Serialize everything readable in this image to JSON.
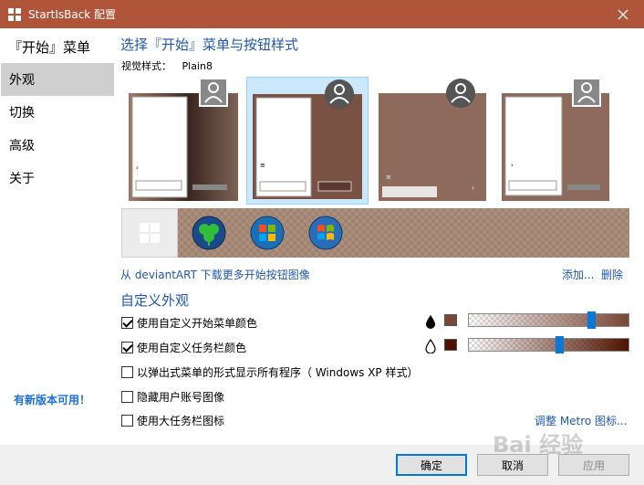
{
  "window": {
    "title": "StartIsBack 配置"
  },
  "sidebar": {
    "heading": "『开始』菜单",
    "items": [
      {
        "label": "外观",
        "active": true
      },
      {
        "label": "切换",
        "active": false
      },
      {
        "label": "高级",
        "active": false
      },
      {
        "label": "关于",
        "active": false
      }
    ],
    "update_link": "有新版本可用！"
  },
  "appearance": {
    "section_title": "选择『开始』菜单与按钮样式",
    "visual_style_label": "视觉样式：",
    "visual_style_value": "Plain8",
    "styles": [
      {
        "name": "style-1",
        "selected": false
      },
      {
        "name": "style-2",
        "selected": true
      },
      {
        "name": "style-3",
        "selected": false
      },
      {
        "name": "style-4",
        "selected": false
      }
    ],
    "orbs": [
      "windows-10-orb-icon",
      "clover-orb-icon",
      "windows-7-orb-icon",
      "windows-vista-orb-icon"
    ],
    "selected_orb": 0,
    "deviantart_link": "从 deviantART 下载更多开始按钮图像",
    "add_link": "添加...",
    "delete_link": "删除"
  },
  "custom": {
    "section_title": "自定义外观",
    "options": [
      {
        "label": "使用自定义开始菜单颜色",
        "checked": true,
        "drop": "filled",
        "swatch": "#7a4638",
        "slider_value": 0.78,
        "slider_color": "#7a4638"
      },
      {
        "label": "使用自定义任务栏颜色",
        "checked": true,
        "drop": "outline",
        "swatch": "#4f1200",
        "slider_value": 0.56,
        "slider_color": "#4f1200"
      },
      {
        "label": "以弹出式菜单的形式显示所有程序（ Windows XP 样式）",
        "checked": false
      },
      {
        "label": "隐藏用户账号图像",
        "checked": false
      },
      {
        "label": "使用大任务栏图标",
        "checked": false
      }
    ],
    "metro_link": "调整 Metro 图标..."
  },
  "footer": {
    "ok": "确定",
    "cancel": "取消",
    "apply": "应用"
  },
  "watermark": "Bai 经验"
}
